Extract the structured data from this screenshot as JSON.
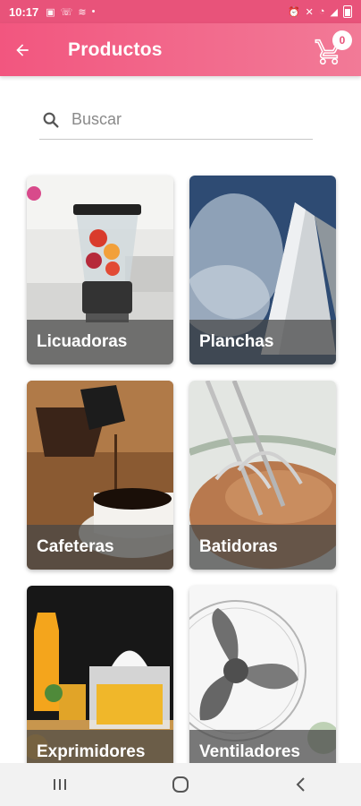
{
  "status_bar": {
    "time": "10:17",
    "left_icons": [
      "image-icon",
      "wifi-calling-icon",
      "volte-icon",
      "dot-icon"
    ],
    "right_icons": [
      "alarm-icon",
      "mute-icon",
      "wifi-icon",
      "signal-icon",
      "battery-icon"
    ]
  },
  "app_bar": {
    "title": "Productos",
    "cart_count": "0",
    "accent_color": "#f2567f"
  },
  "search": {
    "placeholder": "Buscar",
    "value": ""
  },
  "categories": [
    {
      "label": "Licuadoras",
      "image": "blender"
    },
    {
      "label": "Planchas",
      "image": "iron"
    },
    {
      "label": "Cafeteras",
      "image": "coffee-maker"
    },
    {
      "label": "Batidoras",
      "image": "hand-mixer"
    },
    {
      "label": "Exprimidores",
      "image": "juicer"
    },
    {
      "label": "Ventiladores",
      "image": "fan"
    }
  ],
  "nav_bar": {
    "buttons": [
      "recent-apps-icon",
      "home-icon",
      "back-icon"
    ]
  }
}
